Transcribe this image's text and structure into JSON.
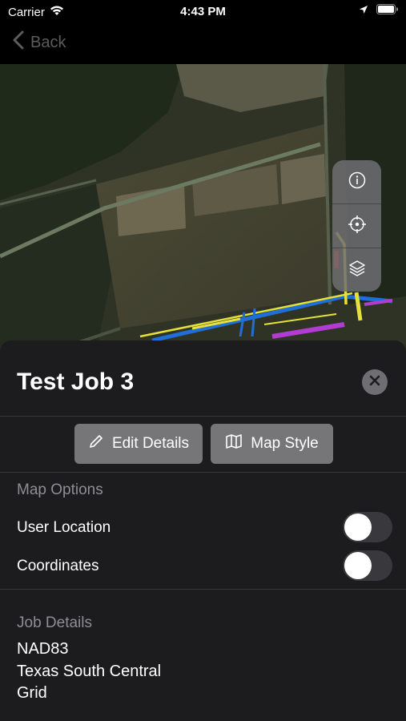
{
  "status_bar": {
    "carrier": "Carrier",
    "time": "4:43 PM"
  },
  "nav": {
    "back_label": "Back"
  },
  "map": {
    "controls": [
      "info-icon",
      "crosshair-icon",
      "layers-icon"
    ]
  },
  "sheet": {
    "title": "Test Job 3",
    "edit_details_label": "Edit Details",
    "map_style_label": "Map Style",
    "map_options_header": "Map Options",
    "user_location_label": "User Location",
    "user_location_on": false,
    "coordinates_label": "Coordinates",
    "coordinates_on": false,
    "job_details_header": "Job Details",
    "job_details": [
      "NAD83",
      "Texas South Central",
      "Grid"
    ]
  },
  "colors": {
    "background": "#000000",
    "sheet": "#1c1c1e",
    "button": "#767678",
    "secondary_text": "#8e8e93",
    "toggle_off": "#39393d",
    "map_line_yellow": "#e6e03a",
    "map_line_blue": "#1f6fd6",
    "map_line_purple": "#b23bd1",
    "map_line_red": "#d92424"
  }
}
